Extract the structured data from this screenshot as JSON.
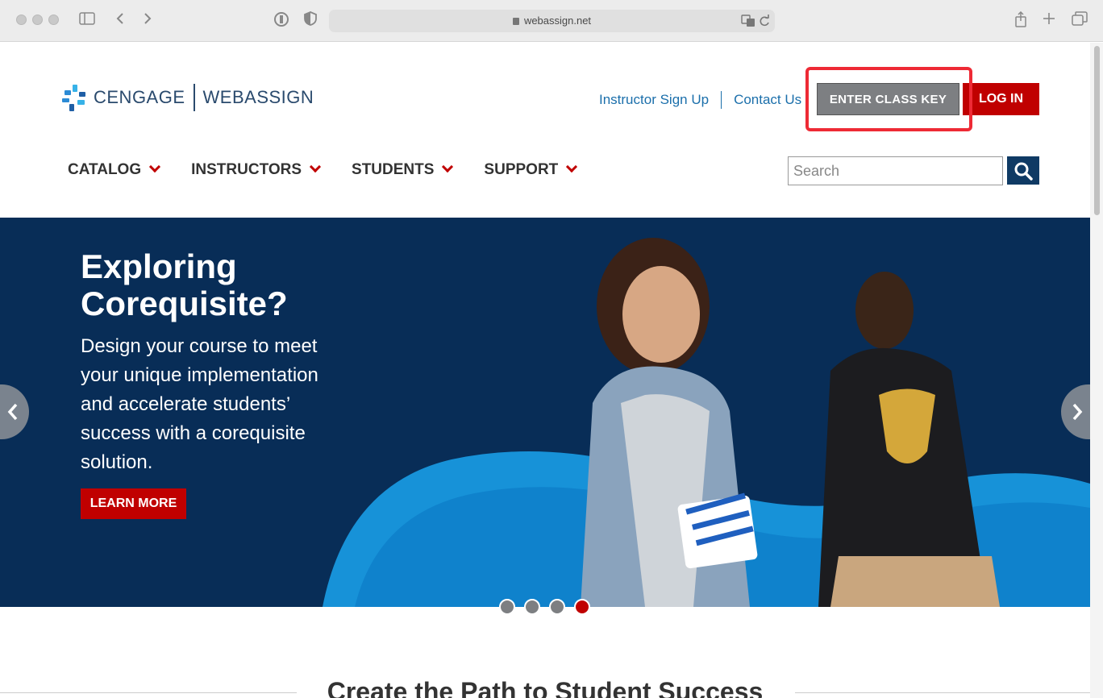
{
  "browser": {
    "url": "webassign.net"
  },
  "header": {
    "logo_left": "CENGAGE",
    "logo_right": "WEBASSIGN",
    "links": [
      "Instructor Sign Up",
      "Contact Us"
    ],
    "class_key_label": "ENTER CLASS KEY",
    "login_label": "LOG IN"
  },
  "nav": {
    "items": [
      "CATALOG",
      "INSTRUCTORS",
      "STUDENTS",
      "SUPPORT"
    ]
  },
  "search": {
    "placeholder": "Search"
  },
  "hero": {
    "title": "Exploring Corequisite?",
    "body": "Design your course to meet your unique implementation and accelerate students’ success with a corequisite solution.",
    "button": "LEARN MORE",
    "slides": 4,
    "active_slide": 4
  },
  "section": {
    "title": "Create the Path to Student Success"
  },
  "colors": {
    "brand_red": "#c00000",
    "brand_navy": "#082d57",
    "link_blue": "#1b6fab",
    "highlight": "#ee2a35"
  }
}
